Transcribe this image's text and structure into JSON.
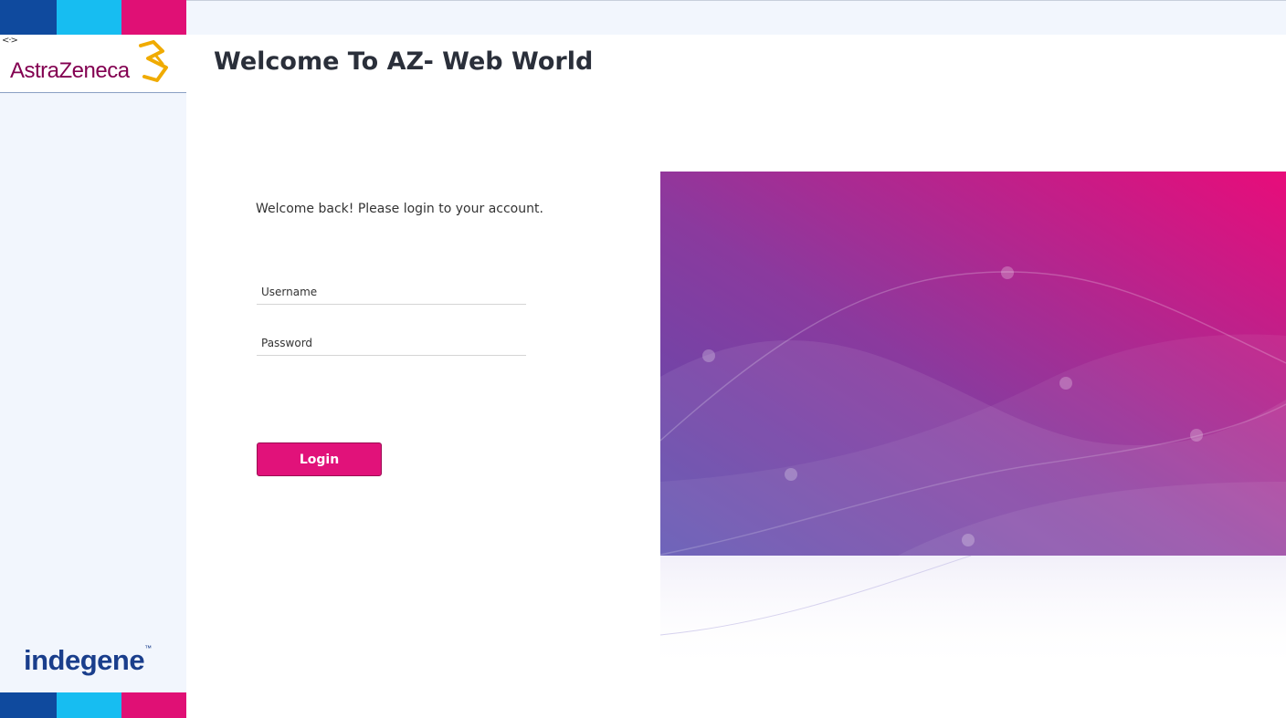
{
  "sidebar": {
    "collapse_icon": "↹",
    "brand_name": "AstraZeneca",
    "footer_brand": "indegene",
    "footer_tm": "™"
  },
  "main": {
    "title": "Welcome To AZ- Web World",
    "welcome_text": "Welcome back! Please login to your account.",
    "username_placeholder": "Username",
    "password_placeholder": "Password",
    "login_label": "Login"
  },
  "colors": {
    "stripe_blue": "#0f4a9e",
    "stripe_cyan": "#17bdf1",
    "stripe_pink": "#e01075",
    "brand_magenta": "#830051",
    "button": "#e1127a"
  }
}
